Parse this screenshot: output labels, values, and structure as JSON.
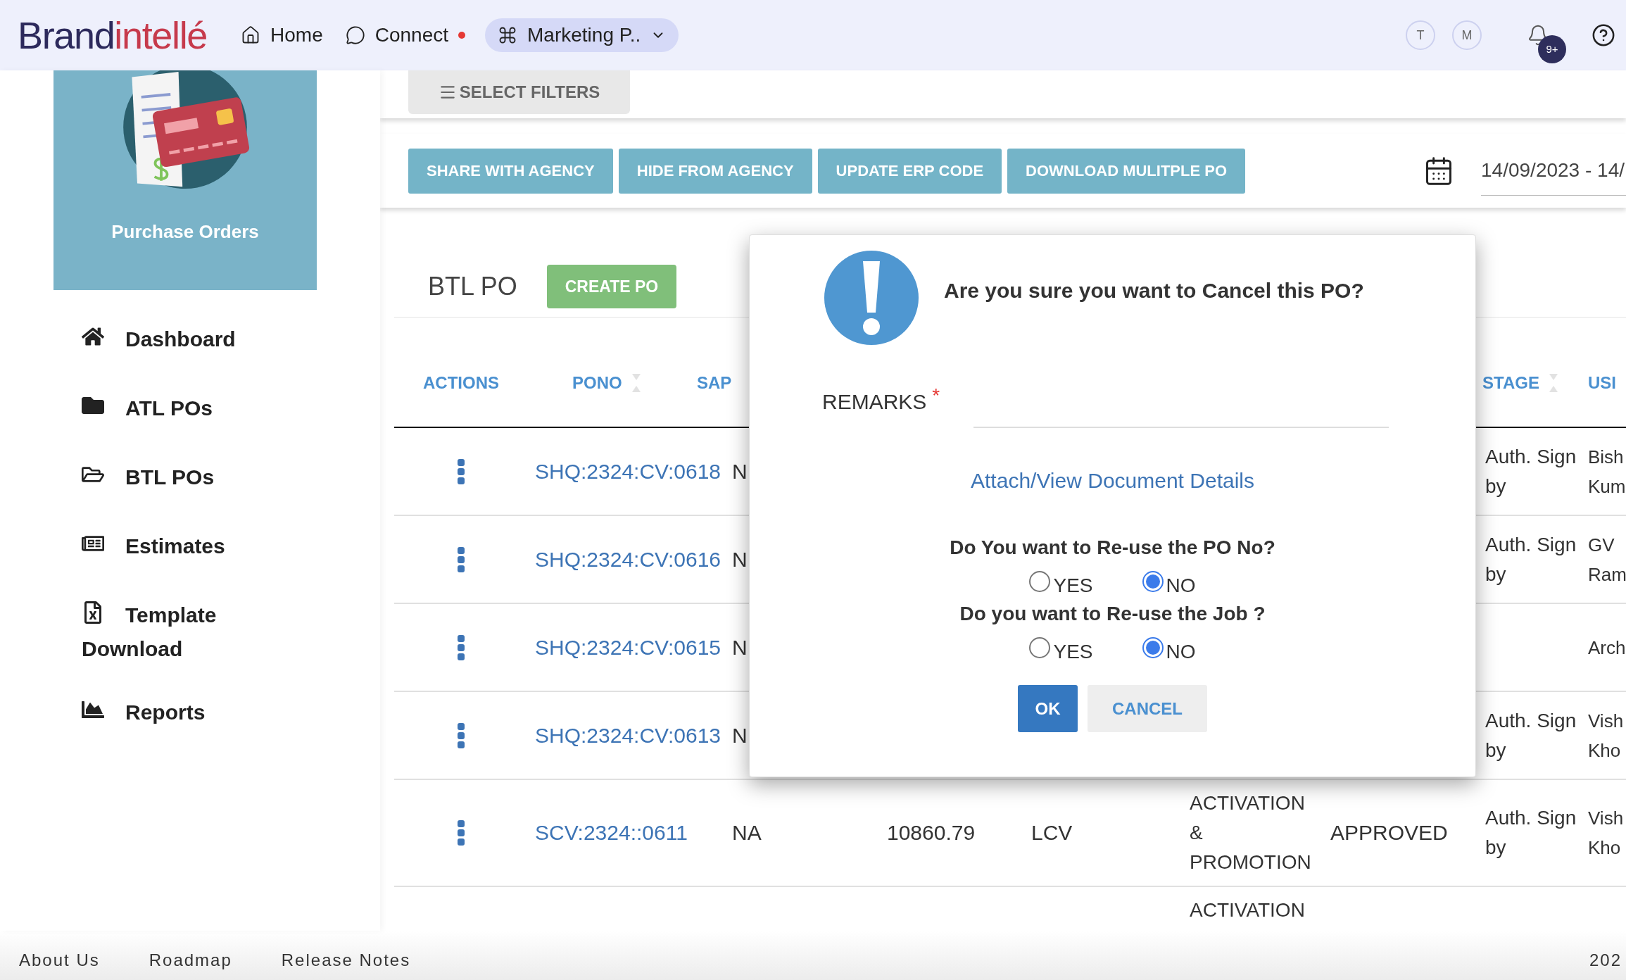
{
  "header": {
    "logo": {
      "part_1": "Brand",
      "part_2": "intellé"
    },
    "nav": [
      {
        "label": "Home",
        "unread": false,
        "dropdown": false
      },
      {
        "label": "Connect",
        "unread": true,
        "dropdown": false
      },
      {
        "label": "Marketing P..",
        "unread": false,
        "dropdown": true
      }
    ],
    "avatars": [
      "T",
      "M"
    ],
    "notification_badge": "9+"
  },
  "sidebar": {
    "card_title": "Purchase Orders",
    "items": [
      {
        "label": "Dashboard"
      },
      {
        "label": "ATL POs"
      },
      {
        "label": "BTL POs"
      },
      {
        "label": "Estimates"
      },
      {
        "label": "Template Download"
      },
      {
        "label": "Reports"
      }
    ]
  },
  "filters_button": "SELECT FILTERS",
  "actions": [
    "SHARE WITH AGENCY",
    "HIDE FROM AGENCY",
    "UPDATE ERP CODE",
    "DOWNLOAD MULITPLE PO"
  ],
  "date_range": "14/09/2023 - 14/",
  "table": {
    "title": "BTL PO",
    "create_button": "CREATE PO",
    "columns": {
      "actions": {
        "label": "ACTIONS",
        "sortable": false
      },
      "pono": {
        "label": "PONO",
        "sortable": true
      },
      "sap": {
        "label": "SAP",
        "sortable": false
      },
      "stage": {
        "label": "STAGE",
        "sortable": true
      },
      "user": {
        "label": "USI",
        "sortable": false
      }
    },
    "rows": [
      {
        "pono": "SHQ:2324:CV:0618",
        "sap": "N",
        "stage": "Auth. Sign by",
        "user": "Bish Kum"
      },
      {
        "pono": "SHQ:2324:CV:0616",
        "sap": "N",
        "stage": "Auth. Sign by",
        "user": "GV Ram"
      },
      {
        "pono": "SHQ:2324:CV:0615",
        "sap": "N",
        "user": "Arch"
      },
      {
        "pono": "SHQ:2324:CV:0613",
        "sap": "N",
        "stage": "Auth. Sign by",
        "user": "Vish Kho"
      },
      {
        "pono": "SCV:2324::0611",
        "sap": "NA",
        "column_4": "10860.79",
        "column_5": "LCV",
        "column_6": "ACTIVATION & PROMOTION",
        "column_7": "APPROVED",
        "stage": "Auth. Sign by",
        "user": "Vish Kho"
      },
      {
        "column_6": "ACTIVATION"
      }
    ]
  },
  "dialog": {
    "title": "Are you sure you want to Cancel this PO?",
    "remarks_label": "REMARKS",
    "required_mark": "*",
    "link": "Attach/View Document Details",
    "questions": [
      {
        "text": "Do You want to Re-use the PO No?",
        "options": [
          {
            "label": "YES",
            "selected": false
          },
          {
            "label": "NO",
            "selected": true
          }
        ]
      },
      {
        "text": "Do you want to Re-use the Job ?",
        "options": [
          {
            "label": "YES",
            "selected": false
          },
          {
            "label": "NO",
            "selected": true
          }
        ]
      }
    ],
    "ok_button": "OK",
    "cancel_button": "CANCEL"
  },
  "footer": {
    "links": [
      "About Us",
      "Roadmap",
      "Release Notes"
    ],
    "year": "202"
  }
}
